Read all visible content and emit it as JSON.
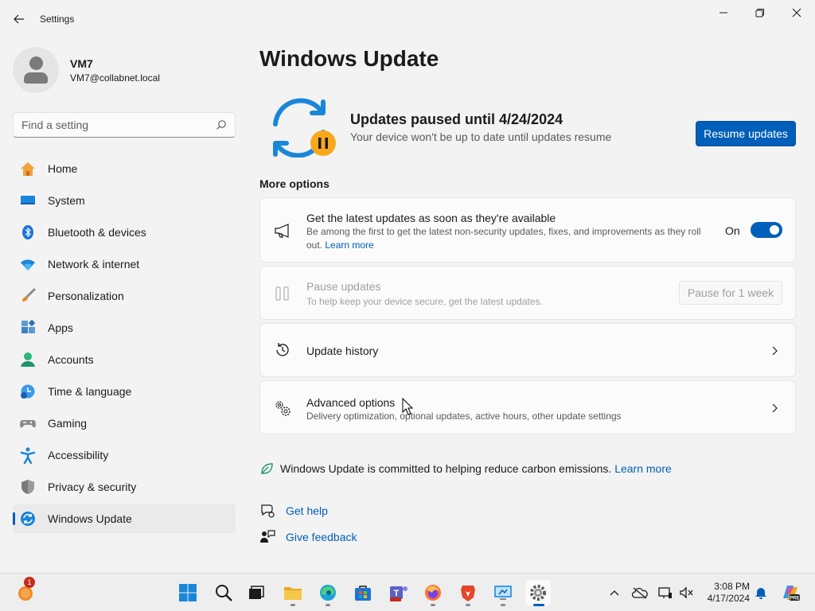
{
  "window": {
    "title": "Settings"
  },
  "user": {
    "name": "VM7",
    "email": "VM7@collabnet.local"
  },
  "search": {
    "placeholder": "Find a setting"
  },
  "nav": [
    {
      "label": "Home",
      "icon": "home-icon"
    },
    {
      "label": "System",
      "icon": "system-icon"
    },
    {
      "label": "Bluetooth & devices",
      "icon": "bluetooth-icon"
    },
    {
      "label": "Network & internet",
      "icon": "wifi-icon"
    },
    {
      "label": "Personalization",
      "icon": "brush-icon"
    },
    {
      "label": "Apps",
      "icon": "apps-icon"
    },
    {
      "label": "Accounts",
      "icon": "accounts-icon"
    },
    {
      "label": "Time & language",
      "icon": "clock-globe-icon"
    },
    {
      "label": "Gaming",
      "icon": "gamepad-icon"
    },
    {
      "label": "Accessibility",
      "icon": "accessibility-icon"
    },
    {
      "label": "Privacy & security",
      "icon": "shield-icon"
    },
    {
      "label": "Windows Update",
      "icon": "update-icon",
      "active": true
    }
  ],
  "page": {
    "title": "Windows Update",
    "status_title": "Updates paused until 4/24/2024",
    "status_sub": "Your device won't be up to date until updates resume",
    "resume_label": "Resume updates",
    "more_options": "More options"
  },
  "cards": {
    "latest": {
      "title": "Get the latest updates as soon as they're available",
      "desc": "Be among the first to get the latest non-security updates, fixes, and improvements as they roll out.",
      "link": "Learn more",
      "toggle_label": "On"
    },
    "pause": {
      "title": "Pause updates",
      "desc": "To help keep your device secure, get the latest updates.",
      "button": "Pause for 1 week"
    },
    "history": {
      "title": "Update history"
    },
    "advanced": {
      "title": "Advanced options",
      "desc": "Delivery optimization, optional updates, active hours, other update settings"
    }
  },
  "carbon": {
    "text": "Windows Update is committed to helping reduce carbon emissions.",
    "link": "Learn more"
  },
  "help": {
    "get_help": "Get help",
    "feedback": "Give feedback"
  },
  "taskbar": {
    "time": "3:08 PM",
    "date": "4/17/2024",
    "notification_count": "1"
  },
  "colors": {
    "accent": "#005fb8",
    "background": "#f3f3f3"
  }
}
